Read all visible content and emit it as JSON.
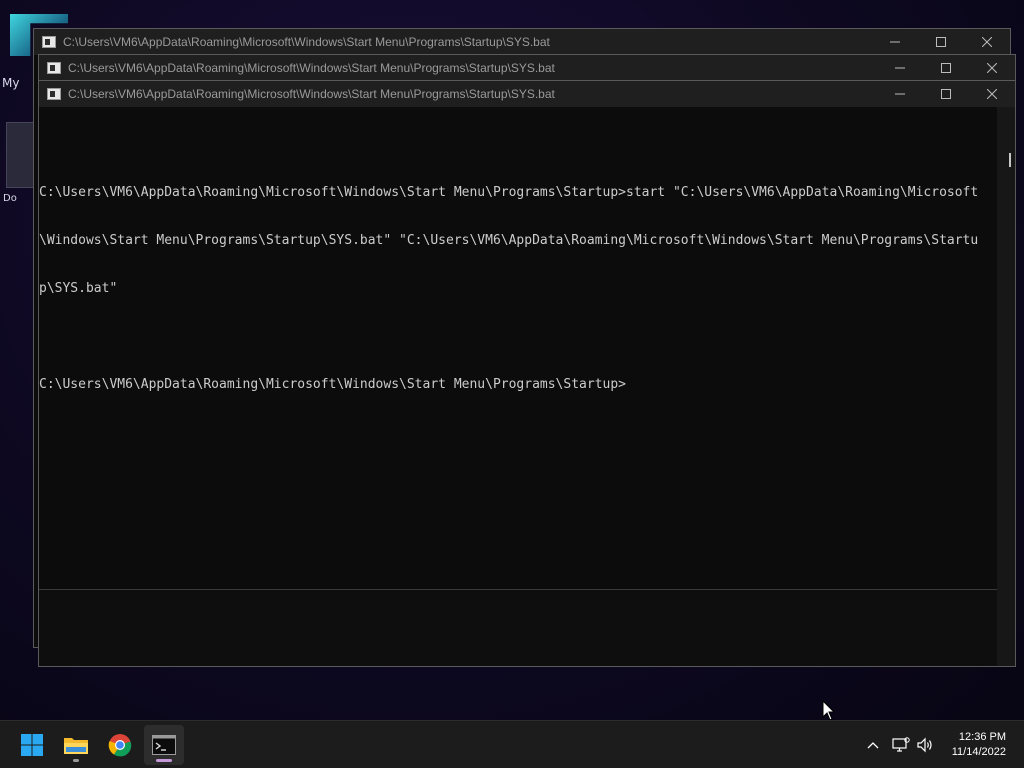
{
  "desktop": {
    "label_my": "My",
    "label_do": "Do"
  },
  "windows": [
    {
      "title": "C:\\Users\\VM6\\AppData\\Roaming\\Microsoft\\Windows\\Start Menu\\Programs\\Startup\\SYS.bat"
    },
    {
      "title": "C:\\Users\\VM6\\AppData\\Roaming\\Microsoft\\Windows\\Start Menu\\Programs\\Startup\\SYS.bat"
    },
    {
      "title": "C:\\Users\\VM6\\AppData\\Roaming\\Microsoft\\Windows\\Start Menu\\Programs\\Startup\\SYS.bat"
    }
  ],
  "console": {
    "lines": [
      "C:\\Users\\VM6\\AppData\\Roaming\\Microsoft\\Windows\\Start Menu\\Programs\\Startup>start \"C:\\Users\\VM6\\AppData\\Roaming\\Microsoft",
      "\\Windows\\Start Menu\\Programs\\Startup\\SYS.bat\" \"C:\\Users\\VM6\\AppData\\Roaming\\Microsoft\\Windows\\Start Menu\\Programs\\Startu",
      "p\\SYS.bat\"",
      "",
      "C:\\Users\\VM6\\AppData\\Roaming\\Microsoft\\Windows\\Start Menu\\Programs\\Startup>"
    ]
  },
  "taskbar": {
    "apps": [
      "windows-start",
      "file-explorer",
      "chrome",
      "command-prompt"
    ],
    "active_app": "command-prompt",
    "tray_icons": [
      "chevron-up-icon",
      "network-icon",
      "volume-icon"
    ]
  },
  "clock": {
    "time": "12:36 PM",
    "date": "11/14/2022"
  },
  "colors": {
    "console_bg": "#0c0c0c",
    "console_text": "#cccccc",
    "titlebar": "#1f1f1f",
    "taskbar": "#1c1c1c",
    "start_blue": "#2aa8f2"
  }
}
